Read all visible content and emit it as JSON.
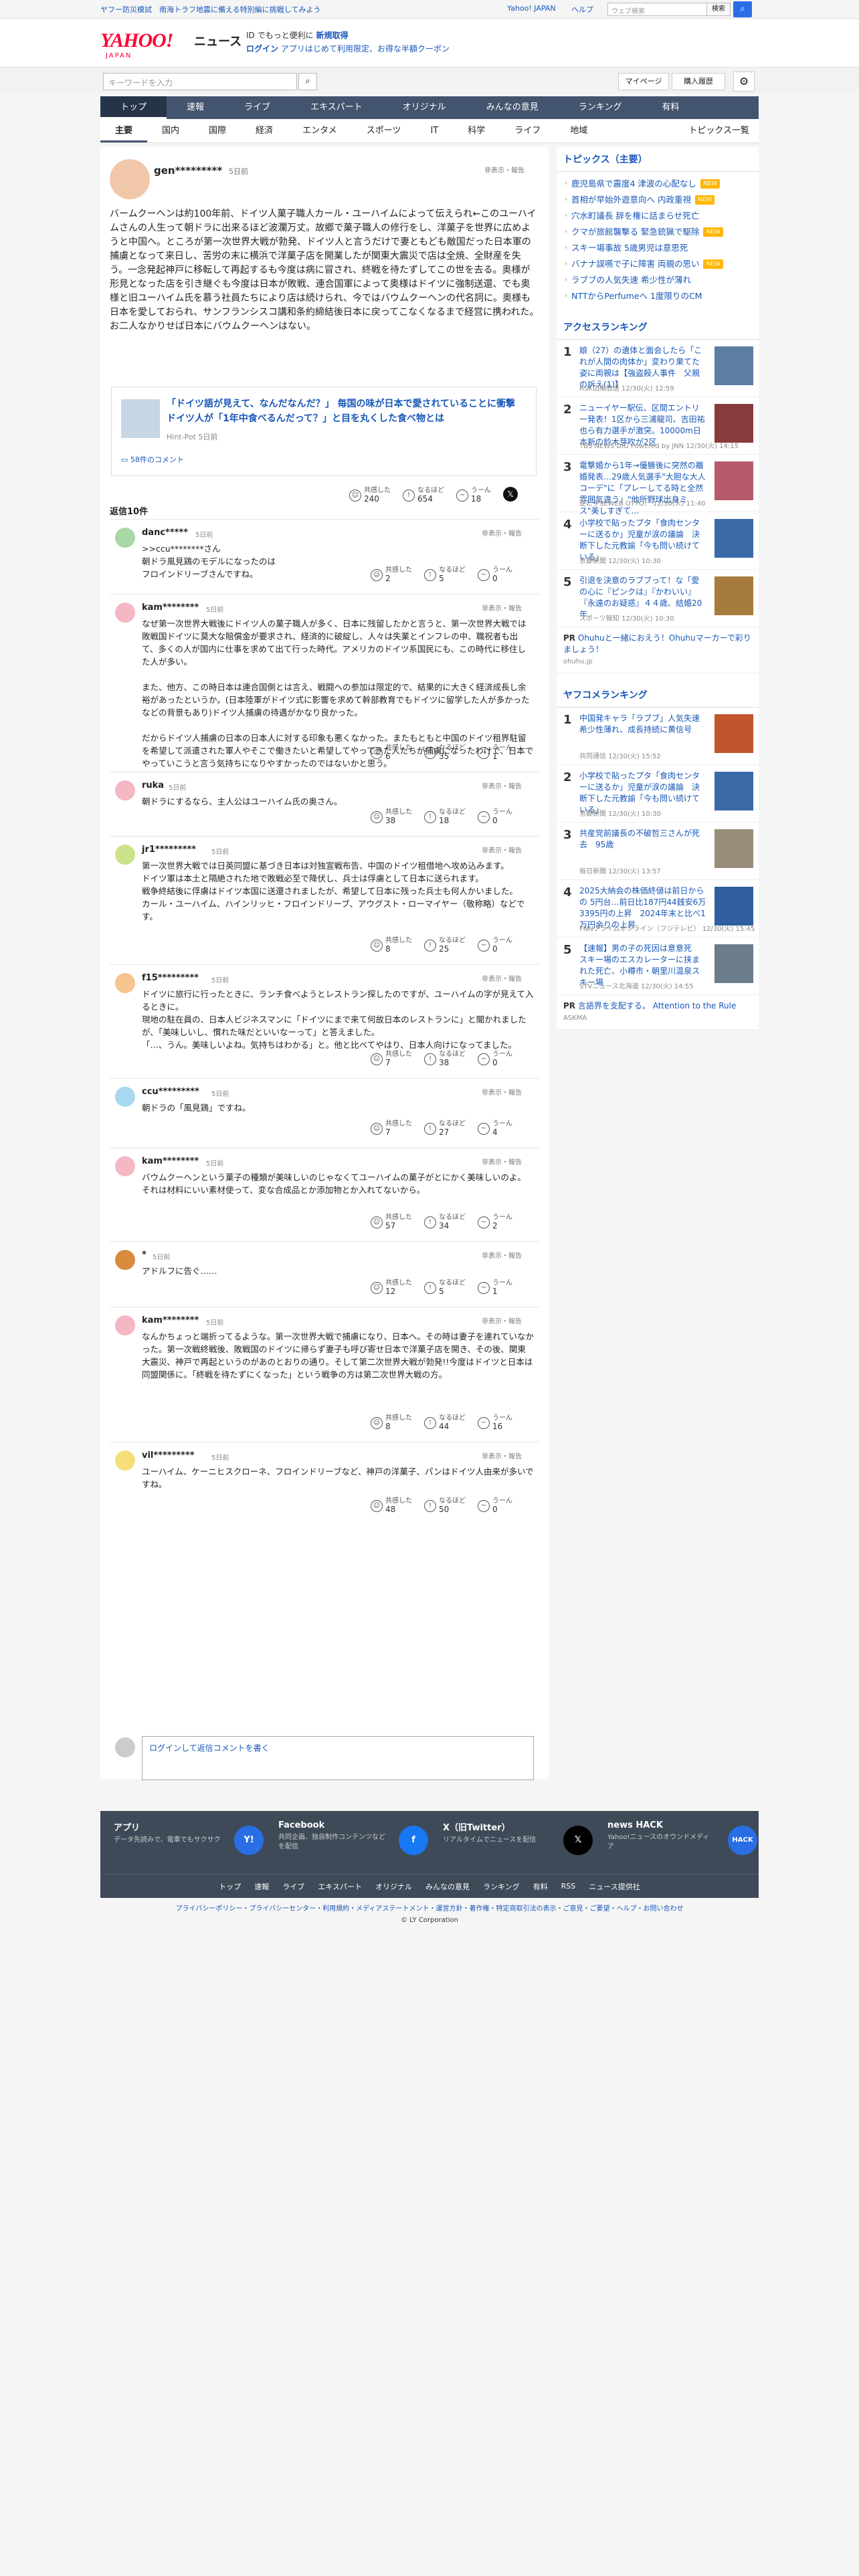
{
  "topbar": {
    "crisis": "ヤフー防災模試　南海トラフ地震に備える特別編に挑戦してみよう",
    "sites": "Yahoo! JAPAN",
    "help": "ヘルプ",
    "search_placeholder": "ウェブ検索",
    "search_button": "検索"
  },
  "header": {
    "logo": "YAHOO!",
    "logo_sub": "JAPAN",
    "news": "ニュース",
    "promo1_pre": "ID でもっと便利に",
    "promo1_link": "新規取得",
    "promo2_link": "ログイン",
    "promo2_post": "アプリはじめて利用限定、お得な半額クーポン"
  },
  "search": {
    "placeholder": "キーワードを入力",
    "mypage": "マイページ",
    "history": "購入履歴"
  },
  "nav": {
    "categories": [
      "トップ",
      "速報",
      "ライブ",
      "エキスパート",
      "オリジナル",
      "みんなの意見",
      "ランキング",
      "有料"
    ],
    "sub": [
      "主要",
      "国内",
      "国際",
      "経済",
      "エンタメ",
      "スポーツ",
      "IT",
      "科学",
      "ライフ",
      "地域"
    ],
    "sub_right": "トピックス一覧"
  },
  "article": {
    "username": "gen*********",
    "date": "5日前",
    "report": "非表示・報告",
    "body": "バームクーヘンは約100年前、ドイツ人菓子職人カール・ユーハイムによって伝えられ←このユーハイムさんの人生って朝ドラに出来るほど波瀾万丈。故郷で菓子職人の修行をし、洋菓子を世界に広めようと中国へ。ところが第一次世界大戦が勃発、ドイツ人と言うだけで妻ともども敵国だった日本軍の捕虜となって来日し、苦労の末に横浜で洋菓子店を開業したが関東大震災で店は全焼、全財産を失う。一念発起神戸に移転して再起するも今度は病に冒され、終戦を待たずしてこの世を去る。奥様が形見となった店を引き継ぐも今度は日本が敗戦、連合国軍によって奥様はドイツに強制送還、でも奥様と旧ユーハイム氏を慕う社員たちにより店は続けられ、今ではバウムクーヘンの代名詞に。奥様も日本を愛しておられ、サンフランシスコ講和条約締結後日本に戻ってこなくなるまで経営に携われた。お二人なかりせば日本にバウムクーヘンはない。",
    "card": {
      "title": "「ドイツ語が見えて、なんだなんだ？」 毎国の味が日本で愛されていることに衝撃　ドイツ人が「1年中食べるんだって？」と目を丸くした食べ物とは",
      "source": "Hint-Pot 5日前",
      "comments": "58件のコメント"
    },
    "reactions": {
      "agree_label": "共感した",
      "agree": "240",
      "naruhodo_label": "なるほど",
      "naruhodo": "654",
      "uun_label": "うーん",
      "uun": "18"
    },
    "x_label": "𝕏"
  },
  "replies_count": "返信10件",
  "replies": [
    {
      "name": "danc*****",
      "date": "5日前",
      "color": "#a9d7a5",
      "text": ">>ccu********さん\n朝ドラ風見鶏のモデルになったのは\nフロインドリーブさんですね。",
      "agree": "2",
      "naruhodo": "5",
      "uun": "0"
    },
    {
      "name": "kam********",
      "date": "5日前",
      "color": "#f4b7c3",
      "text": "なぜ第一次世界大戦後にドイツ人の菓子職人が多く、日本に残留したかと言うと、第一次世界大戦では敗戦国ドイツに莫大な賠償金が要求され、経済的に破綻し、人々は失業とインフレの中、職祝者も出て、多くの人が国内に仕事を求めて出て行った時代。アメリカのドイツ系国民にも、この時代に移住した人が多い。\n\nまた、他方、この時日本は連合国側とは言え、戦闘への参加は限定的で、結果的に大きく経済成長し余裕があったというか。(日本陸軍がドイツ式に影響を求めて幹部教育でもドイツに留学した人が多かったなどの背景もあり)ドイツ人捕虜の待遇がかなり良かった。\n\nだからドイツ人捕虜の日本の日本人に対する印象も悪くなかった。またもともと中国のドイツ租界駐留を希望して派遣された軍人やそこで働きたいと希望してやってきた人たちが捕虜になったわけで、日本でやっていこうと言う気持ちになりやすかったのではないかと思う。",
      "agree": "6",
      "naruhodo": "35",
      "uun": "1"
    },
    {
      "name": "ruka",
      "date": "5日前",
      "color": "#f4b7c3",
      "text": "朝ドラにするなら、主人公はユーハイム氏の奥さん。",
      "agree": "38",
      "naruhodo": "18",
      "uun": "0"
    },
    {
      "name": "jr1*********",
      "date": "5日前",
      "color": "#cce28a",
      "text": "第一次世界大戦では日英同盟に基づき日本は対独宣戦布告、中国のドイツ租借地へ攻め込みます。\nドイツ軍は本土と隔絶された地で敗戦必至で降伏し、兵士は俘虜として日本に送られます。\n戦争終結後に俘虜はドイツ本国に送還されましたが、希望して日本に残った兵士も何人かいました。\nカール・ユーハイム、ハインリッヒ・フロインドリーブ、アウグスト・ローマイヤー（敬称略）などです。",
      "agree": "8",
      "naruhodo": "25",
      "uun": "0"
    },
    {
      "name": "f15*********",
      "date": "5日前",
      "color": "#f7c48f",
      "text": "ドイツに旅行に行ったときに、ランチ食べようとレストラン探したのですが、ユーハイムの字が見えて入るときに。\n現地の駐在員の、日本人ビジネスマンに「ドイツにまで来て何故日本のレストランに」と聞かれましたが、「美味しいし、慣れた味だといいなーって」と答えました。\n「…、うん。美味しいよね。気持ちはわかる」と。他と比べてやはり、日本人向けになってました。",
      "agree": "7",
      "naruhodo": "38",
      "uun": "0"
    },
    {
      "name": "ccu*********",
      "date": "5日前",
      "color": "#a8d8f0",
      "text": "朝ドラの「風見鶏」ですね。",
      "agree": "7",
      "naruhodo": "27",
      "uun": "4"
    },
    {
      "name": "kam********",
      "date": "5日前",
      "color": "#f4b7c3",
      "text": "バウムクーヘンという菓子の種類が美味しいのじゃなくてユーハイムの菓子がとにかく美味しいのよ。それは材料にいい素材使って、変な合成品とか添加物とか入れてないから。",
      "agree": "57",
      "naruhodo": "34",
      "uun": "2"
    },
    {
      "name": "*",
      "date": "5日前",
      "color": "#d88b3c",
      "text": "アドルフに告ぐ……",
      "agree": "12",
      "naruhodo": "5",
      "uun": "1"
    },
    {
      "name": "kam********",
      "date": "5日前",
      "color": "#f4b7c3",
      "text": "なんかちょっと端折ってるような。第一次世界大戦で捕虜になり、日本へ。その時は妻子を連れていなかった。第一次戦終戦後、敗戦国のドイツに帰らず妻子も呼び寄せ日本で洋菓子店を開き、その後、関東大震災、神戸で再起というのがあのとおりの通り。そして第二次世界大戦が勃発!!今度はドイツと日本は同盟関係に。「終戦を待たずにくなった」という戦争の方は第二次世界大戦の方。",
      "agree": "8",
      "naruhodo": "44",
      "uun": "16"
    },
    {
      "name": "vil*********",
      "date": "5日前",
      "color": "#f6de7a",
      "text": "ユーハイム、ケーニヒスクローネ、フロインドリーブなど、神戸の洋菓子、パンはドイツ人由来が多いですね。",
      "agree": "48",
      "naruhodo": "50",
      "uun": "0"
    }
  ],
  "reply_box": {
    "text": "ログインして返信コメントを書く"
  },
  "sidebar": {
    "topics_title": "トピックス（主要）",
    "topics": [
      {
        "text": "鹿児島県で震度4 津波の心配なし",
        "badge": "NEW"
      },
      {
        "text": "首相が早始外遊意向へ 内政重視",
        "badge": "NEW"
      },
      {
        "text": "穴水町議長 辞を権に話まらせ死亡",
        "badge": ""
      },
      {
        "text": "クマが旅館襲撃る 緊急銃猟で駆除",
        "badge": "NEW"
      },
      {
        "text": "スキー場事故 5歳男児は意思死",
        "badge": ""
      },
      {
        "text": "バナナ誤嚥で子に障害 両親の思い",
        "badge": "NEW"
      },
      {
        "text": "ラブブの人気失速 希少性が薄れ",
        "badge": ""
      },
      {
        "text": "NTTからPerfumeへ 1度限りのCM",
        "badge": ""
      }
    ],
    "access_title": "アクセスランキング",
    "access": [
      {
        "no": "1",
        "title": "娘（27）の遺体と面会したら「これが人間の肉体か」変わり果てた姿に両親は【強盗殺人事件　父親の訴え(1)】",
        "src": "RSK山陽放送 12/30(火) 12:59"
      },
      {
        "no": "2",
        "title": "ニューイヤー駅伝、区間エントリー発表！1区から三浦龍司、吉田祐也ら有力選手が激突。10000m日本新の鈴木芽吹が2区",
        "src": "TBS NEWS DIG Powered by JNN 12/30(火) 14:15"
      },
      {
        "no": "3",
        "title": "電撃婚から1年→優勝後に突然の離婚発表…29歳人気選手\"大胆な大人コーデ\"に「プレーしてる時と全然雰囲気違う」\"他所野球出身ミス\"美しすぎて…",
        "src": "逆に手SEWEB OTTO！ 12/30(火) 11:40"
      },
      {
        "no": "4",
        "title": "小学校で貼ったプタ「食肉センターに送るか」児童が涙の議論　決断下した元教諭「今も問い続けている」",
        "src": "京都新聞 12/30(火) 10:30"
      },
      {
        "no": "5",
        "title": "引退を決意のラブブって！な「愛の心に『ピンクは』『かわいい』『永遠のお疑惑』４４歳、結婚20年",
        "src": "スポーツ報知 12/30(火) 10:30"
      }
    ],
    "pr": {
      "title": "Ohuhuと一緒におえう！Ohuhuマーカーで彩りましょう！",
      "src": "ohuhu.jp",
      "label": "PR"
    },
    "yafukore_title": "ヤフコメランキング",
    "yafukore": [
      {
        "no": "1",
        "title": "中国発キャラ「ラブブ」人気失速　希少性薄れ、成長持続に黄信号",
        "src": "共同通信 12/30(火) 15:52"
      },
      {
        "no": "2",
        "title": "小学校で貼ったプタ「食肉センターに送るか」児童が涙の議論　決断下した元教諭「今も問い続けている」",
        "src": "京都新聞 12/30(火) 10:30"
      },
      {
        "no": "3",
        "title": "共産党前議長の不破哲三さんが死去　95歳",
        "src": "毎日新聞 12/30(火) 13:57"
      },
      {
        "no": "4",
        "title": "2025大納会の株価終値は前日からの 5円台…前日比187円44銭安6万3395円の上昇　2024年末と比べ1万円余りの上昇",
        "src": "FNNプライムオンライン（フジテレビ） 12/30(火) 15:45"
      },
      {
        "no": "5",
        "title": "【速報】男の子の死因は意意死　スキー場のエスカレーターに挟まれた死亡、小樽市・朝里川温泉スキー場",
        "src": "STVニュース北海道 12/30(火) 14:55"
      }
    ],
    "pr2": {
      "title": "言語界を支配する。 Attention to the Rule",
      "src": "ASKMA",
      "label": "PR"
    }
  },
  "footer": {
    "apps": [
      {
        "title": "アプリ",
        "desc": "データ先読みで、電車でもサクサク",
        "icon": "Y!"
      },
      {
        "title": "Facebook",
        "desc": "共同企画、独自制作コンテンツなどを配信",
        "icon": "f"
      },
      {
        "title": "X（旧Twitter）",
        "desc": "リアルタイムでニュースを配信",
        "icon": "𝕏"
      },
      {
        "title": "news HACK",
        "desc": "Yahoo!ニュースのオウンドメディア",
        "icon": "HACK"
      }
    ],
    "links": [
      "トップ",
      "速報",
      "ライブ",
      "エキスパート",
      "オリジナル",
      "みんなの意見",
      "ランキング",
      "有料",
      "RSS",
      "ニュース提供社"
    ],
    "legal": "プライバシーポリシー・プライバシーセンター・利用規約・メディアステートメント・運営方針・著作権・特定商取引法の表示・ご意見・ご要望・ヘルプ・お問い合わせ",
    "copyright": "© LY Corporation"
  },
  "colors": {
    "accent": "#ff0033",
    "nav": "#43546e",
    "link": "#1857b8"
  }
}
